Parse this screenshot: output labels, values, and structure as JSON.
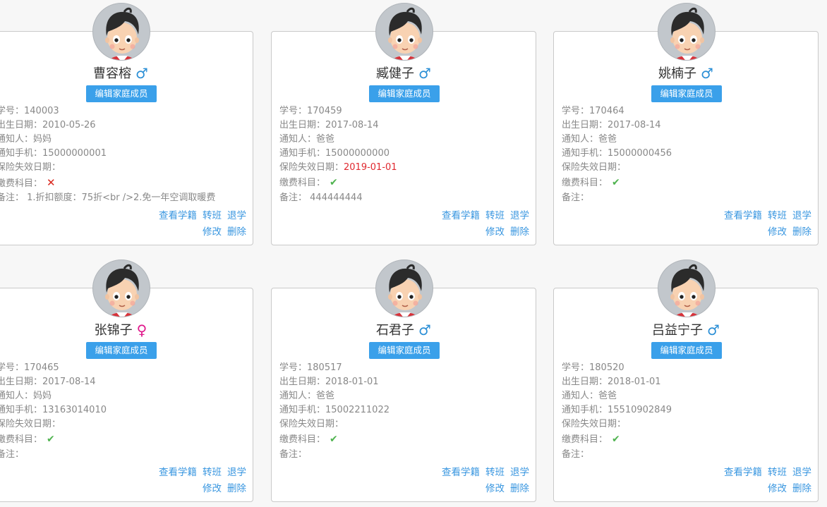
{
  "labels": {
    "student_no": "学号：",
    "birth_date": "出生日期：",
    "notifier": "通知人：",
    "phone": "通知手机：",
    "insurance_expire": "保险失效日期：",
    "fee_subject": "缴费科目：",
    "remark": "备注：",
    "edit_family_button": "编辑家庭成员",
    "view_record": "查看学籍",
    "transfer_class": "转班",
    "withdraw": "退学",
    "edit": "修改",
    "delete": "删除"
  },
  "colors": {
    "accent": "#3aa0ea",
    "male": "#2b8fd6",
    "female": "#e0198c",
    "paid_ok": "#4fb34f",
    "paid_no": "#d9261c",
    "expired_date": "#e0282f"
  },
  "students": [
    {
      "name": "曹容榕",
      "gender": "male",
      "gender_symbol": "♂",
      "student_no": "140003",
      "birth_date": "2010-05-26",
      "notifier": "妈妈",
      "phone": "15000000001",
      "insurance_expire": "",
      "fee_paid": false,
      "fee_icon": "cross-icon",
      "fee_mark": "✕",
      "remark": " 1.折扣额度：75折<br />2.免一年空调取暖费"
    },
    {
      "name": "臧健子",
      "gender": "male",
      "gender_symbol": "♂",
      "student_no": "170459",
      "birth_date": "2017-08-14",
      "notifier": "爸爸",
      "phone": "15000000000",
      "insurance_expire": "2019-01-01",
      "fee_paid": true,
      "fee_icon": "check-icon",
      "fee_mark": "✔",
      "remark": " 444444444"
    },
    {
      "name": "姚楠子",
      "gender": "male",
      "gender_symbol": "♂",
      "student_no": "170464",
      "birth_date": "2017-08-14",
      "notifier": "爸爸",
      "phone": "15000000456",
      "insurance_expire": "",
      "fee_paid": true,
      "fee_icon": "check-icon",
      "fee_mark": "✔",
      "remark": ""
    },
    {
      "name": "张锦子",
      "gender": "female",
      "gender_symbol": "♀",
      "student_no": "170465",
      "birth_date": "2017-08-14",
      "notifier": "妈妈",
      "phone": "13163014010",
      "insurance_expire": "",
      "fee_paid": true,
      "fee_icon": "check-icon",
      "fee_mark": "✔",
      "remark": ""
    },
    {
      "name": "石君子",
      "gender": "male",
      "gender_symbol": "♂",
      "student_no": "180517",
      "birth_date": "2018-01-01",
      "notifier": "爸爸",
      "phone": "15002211022",
      "insurance_expire": "",
      "fee_paid": true,
      "fee_icon": "check-icon",
      "fee_mark": "✔",
      "remark": ""
    },
    {
      "name": "吕益宁子",
      "gender": "male",
      "gender_symbol": "♂",
      "student_no": "180520",
      "birth_date": "2018-01-01",
      "notifier": "爸爸",
      "phone": "15510902849",
      "insurance_expire": "",
      "fee_paid": true,
      "fee_icon": "check-icon",
      "fee_mark": "✔",
      "remark": ""
    }
  ]
}
